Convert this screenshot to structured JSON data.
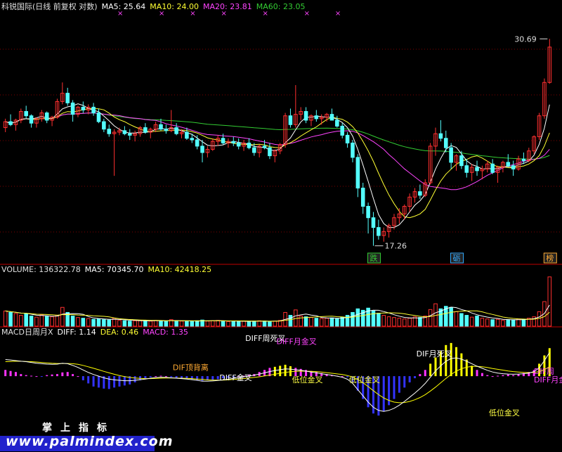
{
  "header_price": {
    "name": "科锐国际(日线 前复权 对数)",
    "ma5": "MA5: 25.64",
    "ma10": "MA10: 24.00",
    "ma20": "MA20: 23.81",
    "ma60": "MA60: 23.05"
  },
  "header_volume": {
    "name": "VOLUME: 136322.78",
    "ma5": "MA5: 70345.70",
    "ma10": "MA10: 42418.25"
  },
  "header_macd": {
    "name": "MACD日周月X",
    "diff": "DIFF: 1.14",
    "dea": "DEA: 0.46",
    "macd": "MACD: 1.35"
  },
  "colors": {
    "up": "#ff3030",
    "down": "#54ffff",
    "ma5": "#ffffff",
    "ma10": "#ffff33",
    "ma20": "#ff44ff",
    "ma60": "#33cc33",
    "grid": "#800000",
    "axis": "#c00000",
    "dea": "#ffff00",
    "diff": "#ffffff",
    "macd_up": "#ff33ff",
    "macd_up2": "#ffff00",
    "macd_dn": "#3333ff"
  },
  "watermark": {
    "cn": "掌上指标",
    "url": "www.palmindex.com"
  },
  "chart_data": [
    {
      "type": "candlestick",
      "title": "科锐国际(日线 前复权 对数)",
      "scale": "log",
      "ylim": [
        16.5,
        33
      ],
      "price_high_label": "30.69",
      "price_low_label": "17.26",
      "events": [
        {
          "index": 71,
          "text": "跌"
        },
        {
          "index": 87,
          "text": "砺"
        },
        {
          "index": 105,
          "text": "榜"
        }
      ],
      "top_markers": "×",
      "ohlc": [
        [
          24.0,
          24.6,
          23.7,
          24.4
        ],
        [
          24.4,
          24.9,
          24.1,
          24.2
        ],
        [
          24.2,
          24.6,
          23.8,
          24.5
        ],
        [
          24.5,
          25.3,
          24.3,
          25.1
        ],
        [
          25.1,
          25.5,
          24.6,
          24.8
        ],
        [
          24.8,
          24.9,
          24.0,
          24.3
        ],
        [
          24.3,
          24.7,
          24.0,
          24.6
        ],
        [
          24.6,
          25.2,
          24.4,
          25.0
        ],
        [
          25.0,
          25.1,
          24.3,
          24.5
        ],
        [
          24.5,
          24.8,
          24.1,
          24.7
        ],
        [
          24.7,
          26.0,
          24.6,
          25.8
        ],
        [
          25.8,
          27.2,
          25.6,
          26.4
        ],
        [
          26.4,
          26.8,
          25.5,
          25.7
        ],
        [
          25.7,
          25.9,
          24.4,
          24.9
        ],
        [
          24.9,
          25.5,
          24.7,
          25.4
        ],
        [
          25.4,
          25.8,
          25.0,
          25.2
        ],
        [
          25.2,
          25.6,
          24.9,
          25.4
        ],
        [
          25.4,
          25.7,
          24.8,
          25.0
        ],
        [
          25.0,
          25.3,
          24.3,
          24.4
        ],
        [
          24.4,
          24.6,
          23.7,
          23.9
        ],
        [
          23.9,
          24.2,
          23.4,
          23.6
        ],
        [
          23.6,
          23.9,
          21.0,
          23.7
        ],
        [
          23.7,
          24.0,
          23.5,
          23.8
        ],
        [
          23.8,
          24.1,
          23.5,
          23.6
        ],
        [
          23.6,
          23.9,
          23.2,
          23.5
        ],
        [
          23.5,
          23.8,
          23.1,
          23.6
        ],
        [
          23.6,
          24.1,
          23.4,
          24.0
        ],
        [
          24.0,
          24.3,
          23.6,
          23.7
        ],
        [
          23.7,
          24.0,
          23.3,
          23.9
        ],
        [
          23.9,
          24.4,
          23.7,
          24.2
        ],
        [
          24.2,
          24.6,
          23.8,
          23.9
        ],
        [
          23.9,
          24.2,
          23.6,
          23.8
        ],
        [
          23.8,
          25.2,
          23.7,
          24.0
        ],
        [
          24.0,
          24.3,
          23.5,
          23.6
        ],
        [
          23.6,
          23.9,
          23.3,
          23.7
        ],
        [
          23.7,
          24.0,
          23.2,
          23.3
        ],
        [
          23.3,
          23.6,
          23.0,
          23.2
        ],
        [
          23.2,
          23.5,
          22.6,
          22.8
        ],
        [
          22.8,
          23.2,
          21.8,
          22.4
        ],
        [
          22.4,
          22.8,
          22.1,
          22.6
        ],
        [
          22.6,
          23.3,
          22.5,
          23.1
        ],
        [
          23.1,
          23.5,
          22.8,
          23.3
        ],
        [
          23.3,
          23.6,
          22.9,
          23.0
        ],
        [
          23.0,
          23.3,
          22.7,
          23.1
        ],
        [
          23.1,
          23.4,
          22.8,
          23.0
        ],
        [
          23.0,
          23.3,
          22.6,
          22.8
        ],
        [
          22.8,
          23.2,
          22.5,
          23.0
        ],
        [
          23.0,
          23.3,
          22.6,
          22.7
        ],
        [
          22.7,
          23.0,
          22.2,
          22.4
        ],
        [
          22.4,
          22.9,
          22.1,
          22.8
        ],
        [
          22.8,
          23.2,
          22.6,
          22.7
        ],
        [
          22.7,
          23.0,
          22.0,
          22.2
        ],
        [
          22.2,
          22.6,
          21.8,
          22.5
        ],
        [
          22.5,
          23.0,
          22.3,
          22.9
        ],
        [
          22.9,
          25.0,
          22.7,
          24.8
        ],
        [
          24.8,
          25.3,
          24.0,
          24.2
        ],
        [
          24.2,
          27.0,
          24.0,
          24.9
        ],
        [
          24.9,
          25.4,
          24.5,
          25.1
        ],
        [
          25.1,
          25.4,
          24.3,
          24.5
        ],
        [
          24.5,
          24.9,
          24.1,
          24.8
        ],
        [
          24.8,
          25.2,
          24.4,
          24.6
        ],
        [
          24.6,
          24.9,
          24.2,
          24.7
        ],
        [
          24.7,
          25.0,
          24.4,
          24.9
        ],
        [
          24.9,
          25.3,
          24.6,
          24.5
        ],
        [
          24.5,
          24.8,
          24.0,
          24.1
        ],
        [
          24.1,
          24.3,
          23.3,
          23.5
        ],
        [
          23.5,
          23.7,
          22.7,
          23.0
        ],
        [
          23.0,
          23.2,
          21.8,
          22.1
        ],
        [
          22.1,
          22.3,
          19.8,
          20.3
        ],
        [
          20.3,
          20.6,
          18.9,
          19.3
        ],
        [
          19.3,
          19.5,
          17.9,
          18.7
        ],
        [
          18.7,
          19.0,
          17.3,
          18.2
        ],
        [
          18.2,
          18.6,
          17.6,
          17.8
        ],
        [
          17.8,
          18.2,
          17.5,
          18.0
        ],
        [
          18.0,
          18.4,
          17.7,
          18.3
        ],
        [
          18.3,
          18.9,
          18.1,
          18.7
        ],
        [
          18.7,
          19.2,
          18.4,
          18.9
        ],
        [
          18.9,
          19.4,
          18.6,
          19.3
        ],
        [
          19.3,
          20.0,
          19.0,
          19.8
        ],
        [
          19.8,
          20.3,
          19.5,
          20.1
        ],
        [
          20.1,
          20.5,
          19.7,
          19.9
        ],
        [
          19.9,
          20.8,
          19.8,
          20.6
        ],
        [
          20.6,
          23.0,
          20.5,
          22.8
        ],
        [
          22.8,
          24.0,
          22.2,
          23.6
        ],
        [
          23.6,
          24.5,
          23.1,
          23.3
        ],
        [
          23.3,
          23.8,
          22.4,
          22.7
        ],
        [
          22.7,
          23.0,
          21.4,
          21.8
        ],
        [
          21.8,
          22.3,
          21.3,
          22.2
        ],
        [
          22.2,
          22.5,
          21.4,
          21.6
        ],
        [
          21.6,
          22.0,
          20.9,
          21.2
        ],
        [
          21.2,
          21.7,
          20.7,
          21.5
        ],
        [
          21.5,
          21.9,
          21.0,
          21.3
        ],
        [
          21.3,
          21.6,
          20.8,
          21.4
        ],
        [
          21.4,
          21.9,
          21.2,
          21.7
        ],
        [
          21.7,
          22.0,
          21.1,
          21.2
        ],
        [
          21.2,
          21.6,
          20.6,
          21.5
        ],
        [
          21.5,
          21.9,
          21.2,
          21.8
        ],
        [
          21.8,
          22.3,
          21.5,
          21.6
        ],
        [
          21.6,
          21.9,
          21.0,
          21.4
        ],
        [
          21.4,
          22.2,
          21.3,
          22.0
        ],
        [
          22.0,
          22.4,
          21.7,
          21.9
        ],
        [
          21.9,
          22.7,
          21.8,
          22.5
        ],
        [
          22.5,
          23.5,
          22.3,
          23.4
        ],
        [
          23.4,
          25.0,
          23.2,
          24.8
        ],
        [
          24.8,
          27.5,
          24.6,
          27.2
        ],
        [
          27.2,
          30.69,
          27.1,
          30.0
        ]
      ]
    },
    {
      "type": "bar",
      "title": "VOLUME",
      "ylim": [
        0,
        140000
      ],
      "values": [
        42000,
        38000,
        35000,
        30000,
        34000,
        28000,
        25000,
        31000,
        27000,
        26000,
        30000,
        52000,
        38000,
        28000,
        24000,
        22000,
        21000,
        19000,
        20000,
        18000,
        17000,
        22000,
        16000,
        15000,
        14000,
        15000,
        16000,
        15000,
        14000,
        16000,
        15000,
        14000,
        18000,
        15000,
        14000,
        13000,
        14000,
        15000,
        17000,
        14000,
        15000,
        16000,
        14000,
        13000,
        14000,
        13000,
        14000,
        13000,
        14000,
        15000,
        14000,
        13000,
        14000,
        16000,
        38000,
        30000,
        45000,
        28000,
        26000,
        24000,
        22000,
        21000,
        22000,
        23000,
        21000,
        25000,
        30000,
        38000,
        48000,
        44000,
        50000,
        42000,
        36000,
        30000,
        26000,
        24000,
        22000,
        20000,
        22000,
        26000,
        24000,
        28000,
        46000,
        62000,
        48000,
        55000,
        52000,
        40000,
        35000,
        30000,
        25000,
        28000,
        22000,
        20000,
        18000,
        19000,
        16000,
        18000,
        17000,
        20000,
        19000,
        22000,
        26000,
        40000,
        68000,
        136322.78
      ]
    },
    {
      "type": "macd",
      "title": "MACD日周月X",
      "ylim": [
        -2.2,
        1.8
      ],
      "values": [
        0.3,
        0.25,
        0.2,
        0.1,
        0.05,
        0.02,
        0.0,
        -0.02,
        0.05,
        0.08,
        0.1,
        0.18,
        0.2,
        0.1,
        0.0,
        -0.2,
        -0.35,
        -0.5,
        -0.55,
        -0.6,
        -0.62,
        -0.55,
        -0.5,
        -0.45,
        -0.4,
        -0.3,
        -0.2,
        -0.1,
        -0.05,
        0.0,
        0.02,
        0.0,
        -0.05,
        -0.08,
        -0.1,
        -0.12,
        -0.15,
        -0.18,
        -0.22,
        -0.2,
        -0.18,
        -0.15,
        -0.1,
        -0.08,
        -0.05,
        0.0,
        0.02,
        0.05,
        0.1,
        0.2,
        0.3,
        0.4,
        0.45,
        0.5,
        0.55,
        0.48,
        0.4,
        0.35,
        0.3,
        0.25,
        0.2,
        0.15,
        0.1,
        0.05,
        0.02,
        0.0,
        -0.05,
        -0.3,
        -0.7,
        -1.1,
        -1.5,
        -1.8,
        -1.9,
        -1.7,
        -1.4,
        -1.1,
        -0.8,
        -0.55,
        -0.3,
        -0.1,
        0.1,
        0.3,
        0.6,
        0.9,
        1.2,
        1.5,
        1.6,
        1.4,
        1.1,
        0.8,
        0.5,
        0.3,
        0.15,
        0.05,
        0.0,
        0.02,
        0.05,
        0.08,
        0.05,
        0.1,
        0.15,
        0.2,
        0.3,
        0.6,
        1.0,
        1.35
      ],
      "diff": [
        0.8,
        0.78,
        0.75,
        0.72,
        0.7,
        0.66,
        0.62,
        0.6,
        0.58,
        0.57,
        0.58,
        0.62,
        0.6,
        0.52,
        0.42,
        0.3,
        0.18,
        0.08,
        0.0,
        -0.08,
        -0.14,
        -0.18,
        -0.2,
        -0.22,
        -0.22,
        -0.2,
        -0.17,
        -0.14,
        -0.1,
        -0.07,
        -0.05,
        -0.06,
        -0.08,
        -0.1,
        -0.12,
        -0.14,
        -0.17,
        -0.2,
        -0.24,
        -0.24,
        -0.23,
        -0.21,
        -0.18,
        -0.15,
        -0.11,
        -0.07,
        -0.03,
        0.0,
        0.05,
        0.1,
        0.16,
        0.22,
        0.27,
        0.31,
        0.35,
        0.34,
        0.31,
        0.28,
        0.24,
        0.2,
        0.16,
        0.12,
        0.08,
        0.04,
        0.0,
        -0.05,
        -0.15,
        -0.35,
        -0.65,
        -0.95,
        -1.25,
        -1.5,
        -1.65,
        -1.7,
        -1.65,
        -1.55,
        -1.4,
        -1.22,
        -1.02,
        -0.82,
        -0.6,
        -0.35,
        -0.05,
        0.25,
        0.5,
        0.72,
        0.85,
        0.88,
        0.82,
        0.72,
        0.6,
        0.48,
        0.38,
        0.28,
        0.2,
        0.15,
        0.12,
        0.1,
        0.09,
        0.1,
        0.12,
        0.15,
        0.22,
        0.4,
        0.75,
        1.14
      ],
      "dea": [
        0.7,
        0.71,
        0.72,
        0.72,
        0.71,
        0.7,
        0.68,
        0.66,
        0.64,
        0.62,
        0.61,
        0.61,
        0.61,
        0.6,
        0.57,
        0.52,
        0.45,
        0.38,
        0.31,
        0.23,
        0.16,
        0.09,
        0.03,
        -0.02,
        -0.06,
        -0.09,
        -0.11,
        -0.12,
        -0.12,
        -0.11,
        -0.1,
        -0.09,
        -0.09,
        -0.09,
        -0.1,
        -0.11,
        -0.12,
        -0.14,
        -0.16,
        -0.18,
        -0.19,
        -0.19,
        -0.19,
        -0.18,
        -0.16,
        -0.14,
        -0.12,
        -0.09,
        -0.06,
        -0.03,
        0.01,
        0.05,
        0.09,
        0.14,
        0.18,
        0.21,
        0.23,
        0.24,
        0.24,
        0.23,
        0.22,
        0.2,
        0.17,
        0.14,
        0.11,
        0.08,
        0.03,
        -0.04,
        -0.16,
        -0.32,
        -0.5,
        -0.7,
        -0.89,
        -1.05,
        -1.17,
        -1.25,
        -1.28,
        -1.27,
        -1.22,
        -1.14,
        -1.03,
        -0.89,
        -0.72,
        -0.53,
        -0.32,
        -0.11,
        0.08,
        0.24,
        0.36,
        0.43,
        0.47,
        0.47,
        0.45,
        0.42,
        0.37,
        0.33,
        0.29,
        0.25,
        0.22,
        0.2,
        0.18,
        0.17,
        0.18,
        0.22,
        0.31,
        0.46
      ]
    }
  ],
  "macd_labels": [
    {
      "text": "DIFF周死叉",
      "color": "#ffffff",
      "index": 49,
      "value": 1.7
    },
    {
      "text": "DIFF月金叉",
      "color": "#ff44ff",
      "index": 55,
      "value": 1.55
    },
    {
      "text": "DIF顶背离",
      "color": "#ffaa33",
      "index": 35,
      "value": 0.3
    },
    {
      "text": "DIFF金叉",
      "color": "#ffffff",
      "index": 44,
      "value": -0.2
    },
    {
      "text": "低位金叉",
      "color": "#ffff44",
      "index": 58,
      "value": -0.3
    },
    {
      "text": "低位金叉",
      "color": "#ffff44",
      "index": 69,
      "value": -0.3
    },
    {
      "text": "DIF月死叉",
      "color": "#ffffff",
      "index": 82,
      "value": 0.95
    },
    {
      "text": "低位金叉",
      "color": "#ffff44",
      "index": 96,
      "value": -1.9
    },
    {
      "text": "DIFF月金叉",
      "color": "#ff44ff",
      "index": 115,
      "value": -0.3
    },
    {
      "text": "DIF周",
      "color": "#ff44ff",
      "index": 126,
      "value": 0.1
    }
  ]
}
